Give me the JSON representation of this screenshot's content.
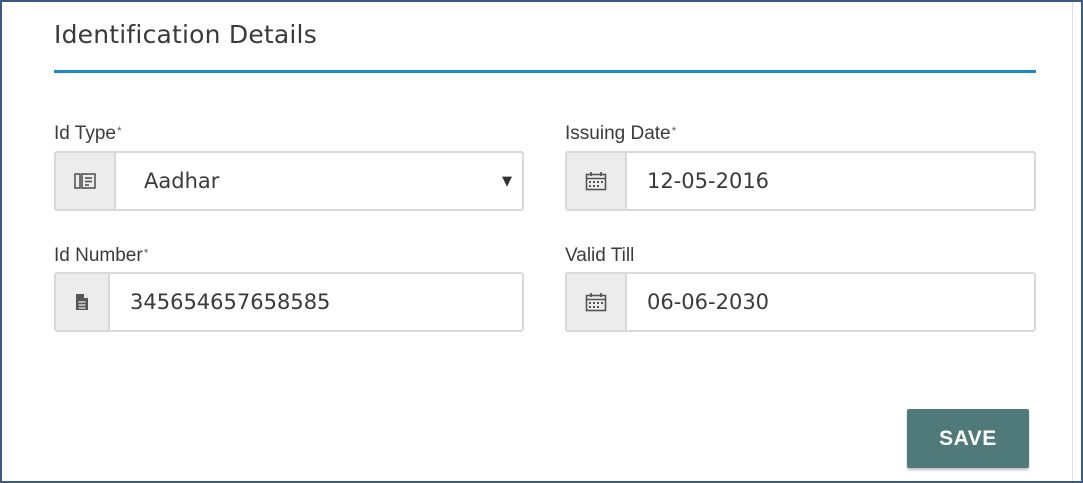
{
  "section": {
    "title": "Identification Details"
  },
  "fields": {
    "id_type": {
      "label": "Id Type",
      "required_mark": "*",
      "value": "Aadhar",
      "icon": "id-card-icon"
    },
    "issuing_date": {
      "label": "Issuing Date",
      "required_mark": "*",
      "value": "12-05-2016",
      "icon": "calendar-icon"
    },
    "id_number": {
      "label": "Id Number",
      "required_mark": "*",
      "value": "345654657658585",
      "icon": "document-icon"
    },
    "valid_till": {
      "label": "Valid Till",
      "value": "06-06-2030",
      "icon": "calendar-icon"
    }
  },
  "actions": {
    "save_label": "SAVE"
  },
  "colors": {
    "accent_rule": "#1e88c7",
    "save_button": "#4f7a79",
    "frame_border": "#3d5a80"
  }
}
